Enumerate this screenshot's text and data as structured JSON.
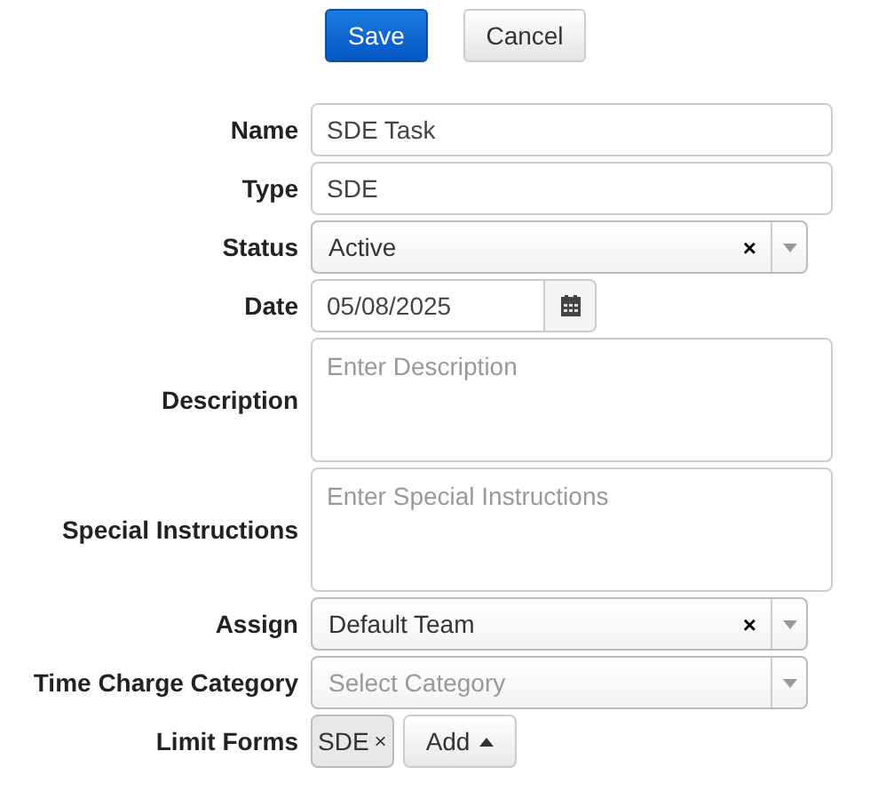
{
  "buttons": [
    {
      "label": "Save",
      "kind": "primary"
    },
    {
      "label": "Cancel",
      "kind": "default"
    }
  ],
  "fields": [
    {
      "label": "Name",
      "kind": "text",
      "value": "SDE Task"
    },
    {
      "label": "Type",
      "kind": "text",
      "value": "SDE"
    },
    {
      "label": "Status",
      "kind": "select",
      "value": "Active",
      "clear": "×"
    },
    {
      "label": "Date",
      "kind": "date",
      "value": "05/08/2025"
    },
    {
      "label": "Description",
      "kind": "textarea",
      "placeholder": "Enter Description"
    },
    {
      "label": "Special Instructions",
      "kind": "textarea",
      "placeholder": "Enter Special Instructions"
    },
    {
      "label": "Assign",
      "kind": "select",
      "value": "Default Team",
      "clear": "×"
    },
    {
      "label": "Time Charge Category",
      "kind": "select",
      "placeholder": "Select Category"
    },
    {
      "label": "Limit Forms",
      "kind": "tags",
      "tags": [
        {
          "label": "SDE",
          "remove": "×"
        }
      ],
      "add": "Add"
    }
  ]
}
